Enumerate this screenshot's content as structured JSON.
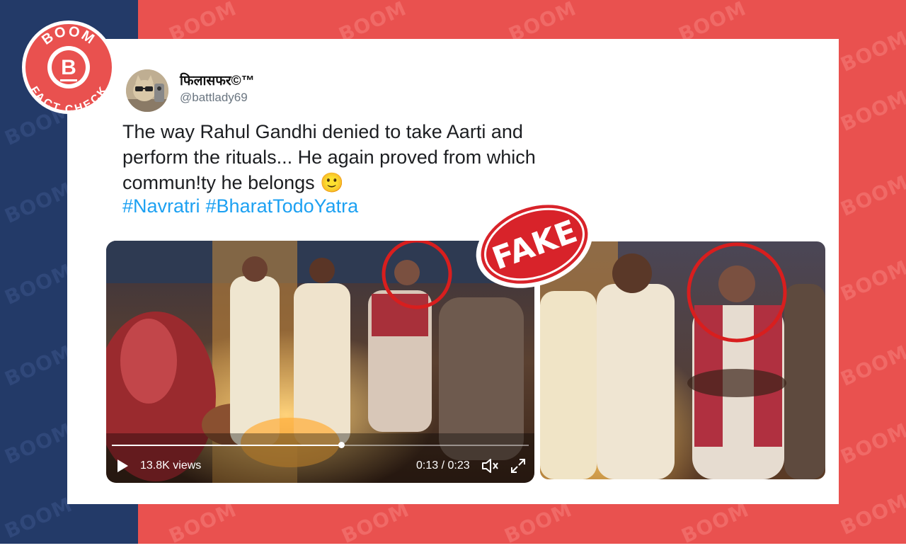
{
  "watermark_text": "BOOM",
  "badge": {
    "top": "BOOM",
    "letter": "B",
    "bottom": "FACT CHECK"
  },
  "stamp": {
    "label": "FAKE"
  },
  "tweet": {
    "display_name": "फिलासफर©™",
    "handle": "@battlady69",
    "text_lines": [
      "The way Rahul Gandhi denied to take Aarti and",
      "perform the rituals... He again proved from which",
      "commun!ty he belongs 🙂"
    ],
    "hashtags": [
      "#Navratri",
      "#BharatTodoYatra"
    ]
  },
  "video": {
    "views": "13.8K views",
    "time": "0:13 / 0:23",
    "progress": 0.55
  },
  "colors": {
    "brand_red": "#e9514f",
    "navy": "#233a68",
    "hashtag_blue": "#1da1f2",
    "circle_red": "#d81e1e"
  }
}
